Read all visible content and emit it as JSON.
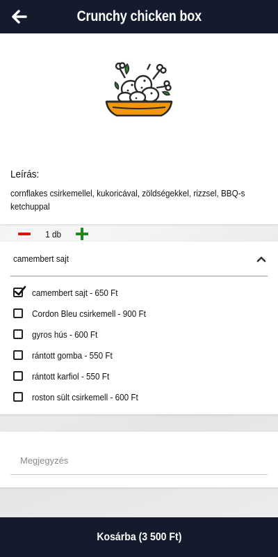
{
  "header": {
    "title": "Crunchy chicken box",
    "back_icon": "arrow-left-icon"
  },
  "product": {
    "image_icon": "chicken-bowl-icon",
    "description_label": "Leírás:",
    "description": "cornflakes csirkemellel, kukoricával, zöldségekkel, rizzsel, BBQ-s ketchuppal",
    "quantity": "1 db"
  },
  "options": {
    "selected": "camembert sajt",
    "items": [
      {
        "label": "camembert sajt - 650 Ft",
        "checked": true
      },
      {
        "label": "Cordon Bleu csirkemell - 900 Ft",
        "checked": false
      },
      {
        "label": "gyros hús - 600 Ft",
        "checked": false
      },
      {
        "label": "rántott gomba - 550 Ft",
        "checked": false
      },
      {
        "label": "rántott karfiol - 550 Ft",
        "checked": false
      },
      {
        "label": "roston sült csirkemell - 600 Ft",
        "checked": false
      }
    ]
  },
  "note": {
    "placeholder": "Megjegyzés",
    "value": ""
  },
  "footer": {
    "cart_label": "Kosárba (3 500 Ft)"
  },
  "colors": {
    "header_bg": "#141b2d",
    "minus": "#d9140f",
    "plus": "#1e8a1e",
    "bowl": "#f0960f"
  }
}
